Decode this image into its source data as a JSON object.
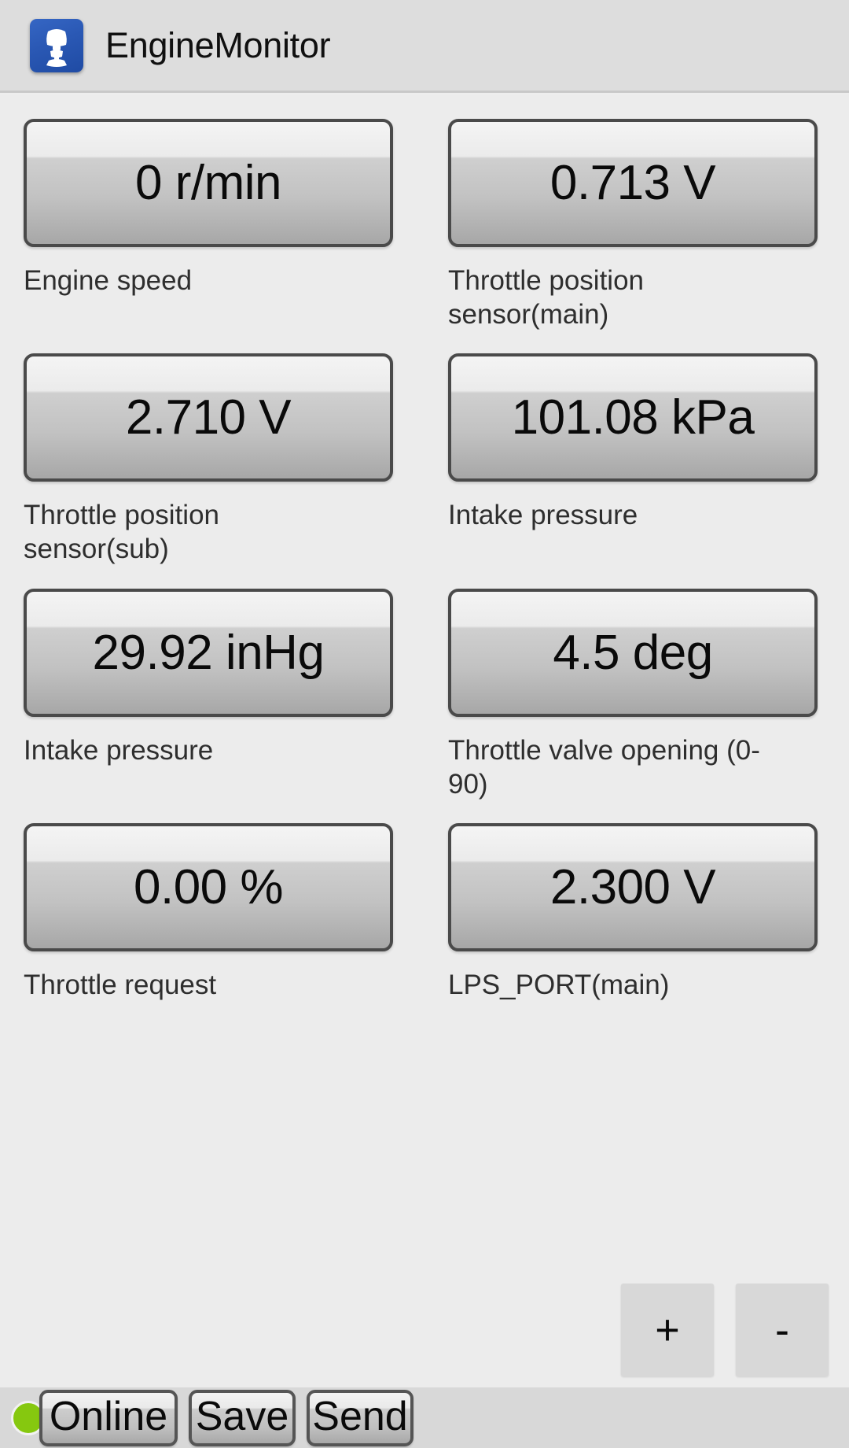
{
  "header": {
    "app_title": "EngineMonitor",
    "icon": "outboard-motor-icon",
    "icon_color": "#2a58b4"
  },
  "gauges": [
    {
      "value": "0 r/min",
      "label": "Engine speed"
    },
    {
      "value": "0.713 V",
      "label": "Throttle position sensor(main)"
    },
    {
      "value": "2.710 V",
      "label": "Throttle position sensor(sub)"
    },
    {
      "value": "101.08 kPa",
      "label": "Intake pressure"
    },
    {
      "value": "29.92 inHg",
      "label": "Intake pressure"
    },
    {
      "value": "4.5 deg",
      "label": "Throttle valve opening (0-90)"
    },
    {
      "value": "0.00 %",
      "label": "Throttle request"
    },
    {
      "value": "2.300 V",
      "label": "LPS_PORT(main)"
    }
  ],
  "stepper": {
    "increase_label": "+",
    "decrease_label": "-"
  },
  "statusbar": {
    "connection_state": "Online",
    "connection_color": "#86c80f",
    "save_label": "Save",
    "send_label": "Send"
  }
}
